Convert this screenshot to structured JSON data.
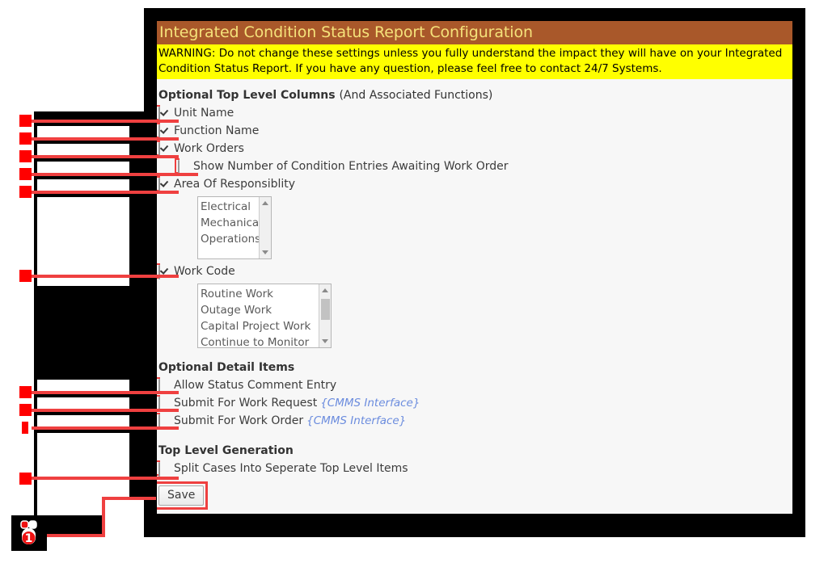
{
  "header": {
    "title": "Integrated Condition Status Report Configuration",
    "title_bg": "#a9582a",
    "title_color": "#f5e27a"
  },
  "warning": {
    "bg": "#ffff00",
    "line1": "WARNING: Do not change these settings unless you fully understand the impact they will have on your Integrated",
    "line2": "Condition Status Report. If you have any question, please feel free to contact 24/7 Systems."
  },
  "sections": {
    "top_level_columns": {
      "title_bold": "Optional Top Level Columns",
      "title_sub": "(And Associated Functions)",
      "items": [
        {
          "label": "Unit Name",
          "checked": true,
          "indent": false
        },
        {
          "label": "Function Name",
          "checked": true,
          "indent": false
        },
        {
          "label": "Work Orders",
          "checked": true,
          "indent": false
        },
        {
          "label": "Show Number of Condition Entries Awaiting Work Order",
          "checked": false,
          "indent": true
        },
        {
          "label": "Area Of Responsiblity",
          "checked": true,
          "indent": false
        }
      ],
      "area_listbox": {
        "options": [
          "Electrical",
          "Mechanical",
          "Operations"
        ],
        "scroll_up": "▲",
        "scroll_down": "▼"
      },
      "work_code_label": "Work Code",
      "work_code_checked": true,
      "work_code_listbox": {
        "options": [
          "Routine Work",
          "Outage Work",
          "Capital Project Work",
          "Continue to Monitor"
        ],
        "scroll_up": "▲",
        "scroll_down": "▼"
      }
    },
    "detail_items": {
      "title_bold": "Optional Detail Items",
      "items": [
        {
          "label": "Allow Status Comment Entry",
          "note": "",
          "checked": false
        },
        {
          "label": "Submit For Work Request",
          "note": "{CMMS Interface}",
          "checked": false
        },
        {
          "label": "Submit For Work Order",
          "note": "{CMMS Interface}",
          "checked": false
        }
      ],
      "note_color": "#6b8cde"
    },
    "top_level_generation": {
      "title_bold": "Top Level Generation",
      "items": [
        {
          "label": "Split Cases Into Seperate Top Level Items",
          "checked": false
        }
      ]
    }
  },
  "save": {
    "label": "Save"
  },
  "annotation": {
    "highlight_color": "#ef4040",
    "marker_color": "#ff0000",
    "click_badge": "1",
    "mouse_icon": "mouse-left-click-icon"
  }
}
